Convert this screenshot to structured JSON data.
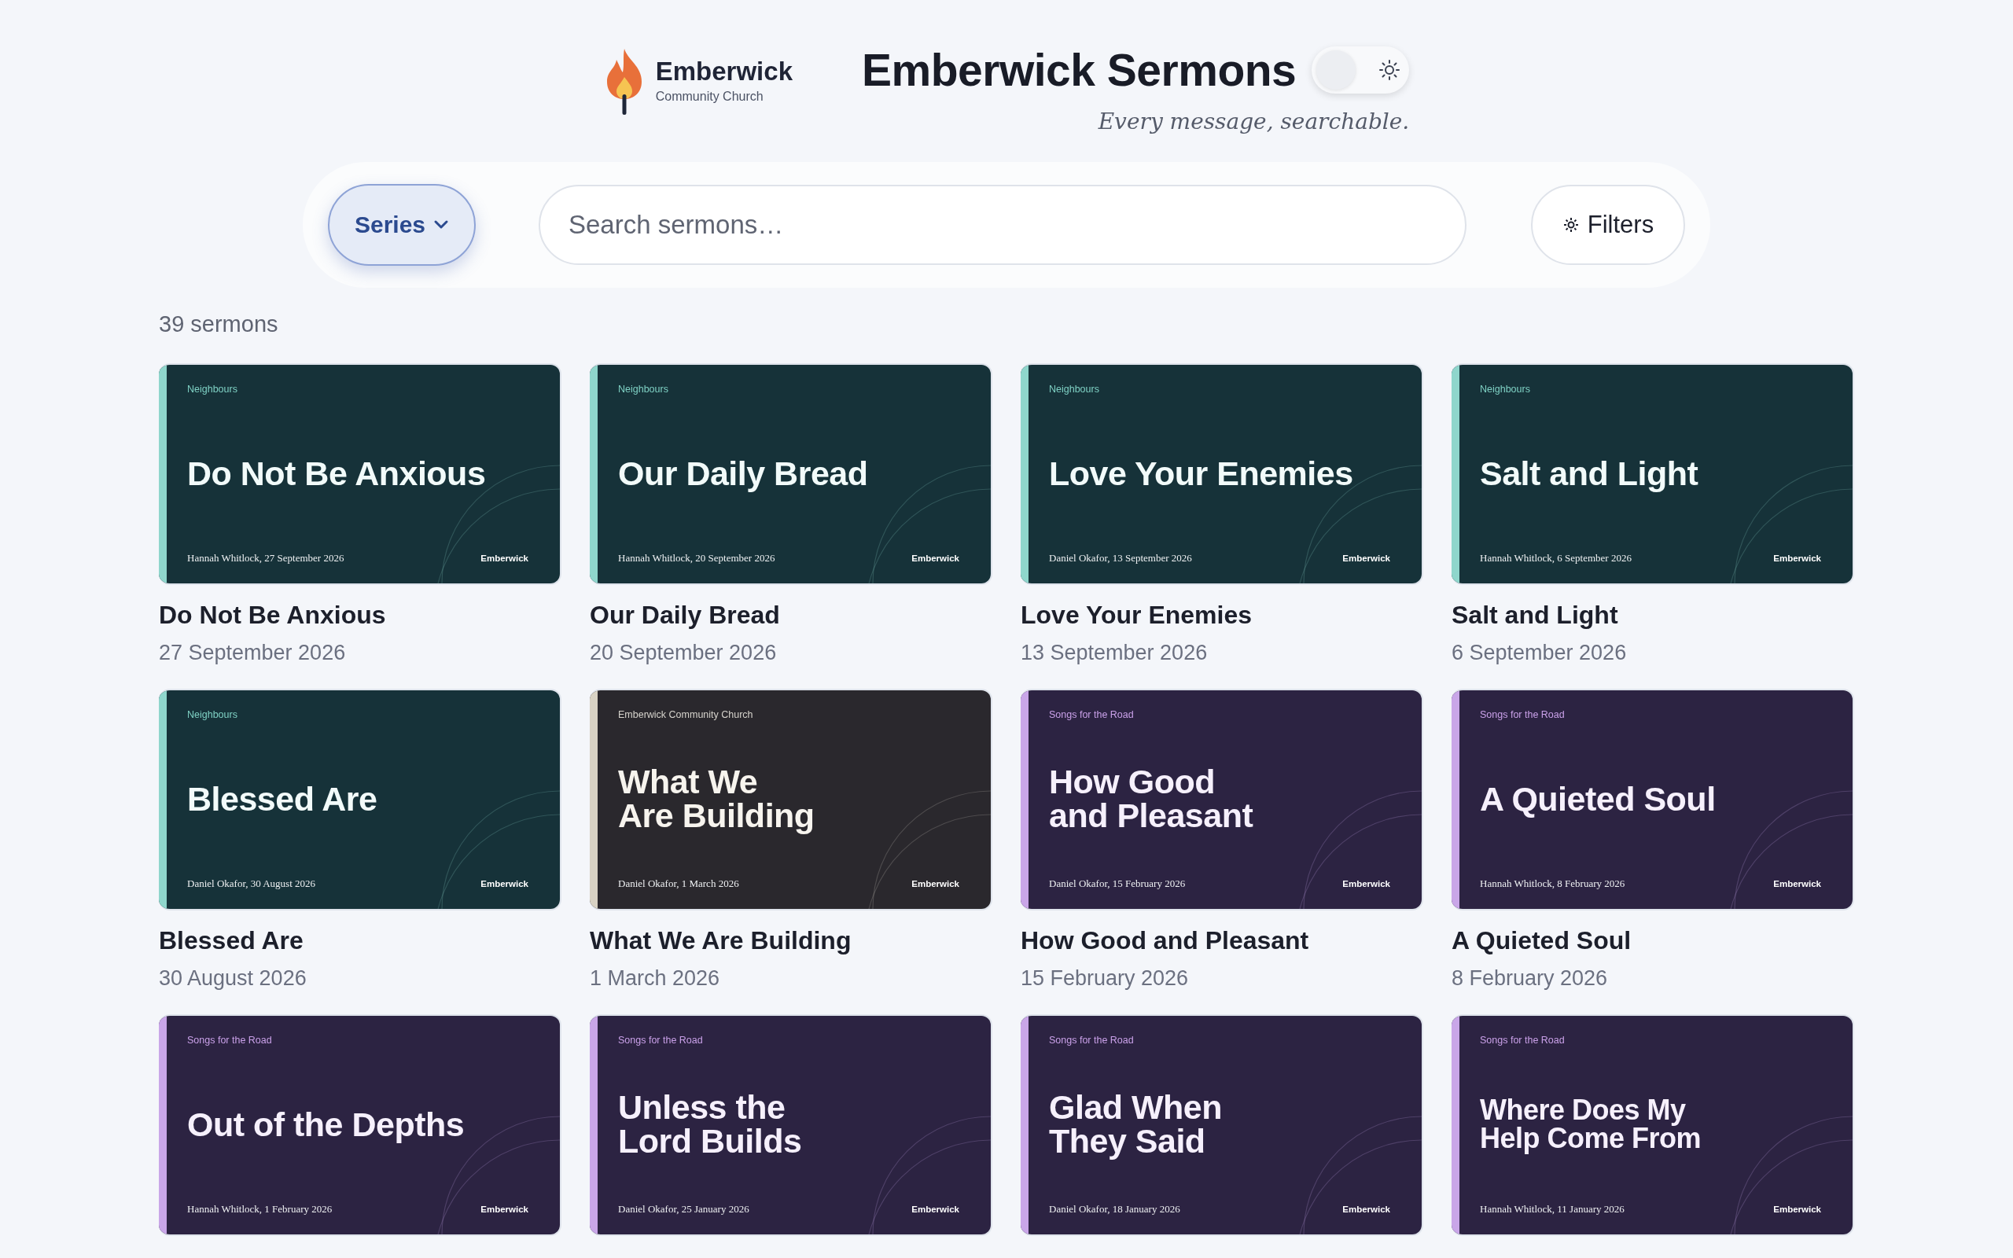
{
  "header": {
    "logo": {
      "name": "Emberwick",
      "subtitle": "Community Church"
    },
    "title": "Emberwick Sermons",
    "theme_toggle": {
      "on": false
    },
    "tagline": "Every message, searchable."
  },
  "search_bar": {
    "series_button": {
      "label": "Series",
      "active": true
    },
    "search": {
      "placeholder": "Search sermons…"
    },
    "filters_button": {
      "label": "Filters"
    }
  },
  "count": "39 sermons",
  "sermons": [
    {
      "kind": "neighbours",
      "series": "Neighbours",
      "cover_title": "Do Not Be Anxious",
      "byline": "Hannah Whitlock, 27 September 2026",
      "mark": "Emberwick",
      "title": "Do Not Be Anxious",
      "date": "27 September 2026"
    },
    {
      "kind": "neighbours",
      "series": "Neighbours",
      "cover_title": "Our Daily Bread",
      "byline": "Hannah Whitlock, 20 September 2026",
      "mark": "Emberwick",
      "title": "Our Daily Bread",
      "date": "20 September 2026"
    },
    {
      "kind": "neighbours",
      "series": "Neighbours",
      "cover_title": "Love Your Enemies",
      "byline": "Daniel Okafor, 13 September 2026",
      "mark": "Emberwick",
      "title": "Love Your Enemies",
      "date": "13 September 2026"
    },
    {
      "kind": "neighbours",
      "series": "Neighbours",
      "cover_title": "Salt and Light",
      "byline": "Hannah Whitlock, 6 September 2026",
      "mark": "Emberwick",
      "title": "Salt and Light",
      "date": "6 September 2026"
    },
    {
      "kind": "neighbours",
      "series": "Neighbours",
      "cover_title": "Blessed Are",
      "byline": "Daniel Okafor, 30 August 2026",
      "mark": "Emberwick",
      "title": "Blessed Are",
      "date": "30 August 2026"
    },
    {
      "kind": "church",
      "series": "Emberwick Community Church",
      "cover_title": "What We\nAre Building",
      "byline": "Daniel Okafor, 1 March 2026",
      "mark": "Emberwick",
      "title": "What We Are Building",
      "date": "1 March 2026"
    },
    {
      "kind": "songs",
      "series": "Songs for the Road",
      "cover_title": "How Good\nand Pleasant",
      "byline": "Daniel Okafor, 15 February 2026",
      "mark": "Emberwick",
      "title": "How Good and Pleasant",
      "date": "15 February 2026"
    },
    {
      "kind": "songs",
      "series": "Songs for the Road",
      "cover_title": "A Quieted Soul",
      "byline": "Hannah Whitlock, 8 February 2026",
      "mark": "Emberwick",
      "title": "A Quieted Soul",
      "date": "8 February 2026"
    },
    {
      "kind": "songs",
      "series": "Songs for the Road",
      "cover_title": "Out of the Depths",
      "byline": "Hannah Whitlock, 1 February 2026",
      "mark": "Emberwick"
    },
    {
      "kind": "songs",
      "series": "Songs for the Road",
      "cover_title": "Unless the\nLord Builds",
      "byline": "Daniel Okafor, 25 January 2026",
      "mark": "Emberwick"
    },
    {
      "kind": "songs",
      "series": "Songs for the Road",
      "cover_title": "Glad When\nThey Said",
      "byline": "Daniel Okafor, 18 January 2026",
      "mark": "Emberwick"
    },
    {
      "kind": "songs",
      "series": "Songs for the Road",
      "cover_title": "Where Does My\nHelp Come From",
      "byline": "Hannah Whitlock, 11 January 2026",
      "mark": "Emberwick"
    }
  ]
}
